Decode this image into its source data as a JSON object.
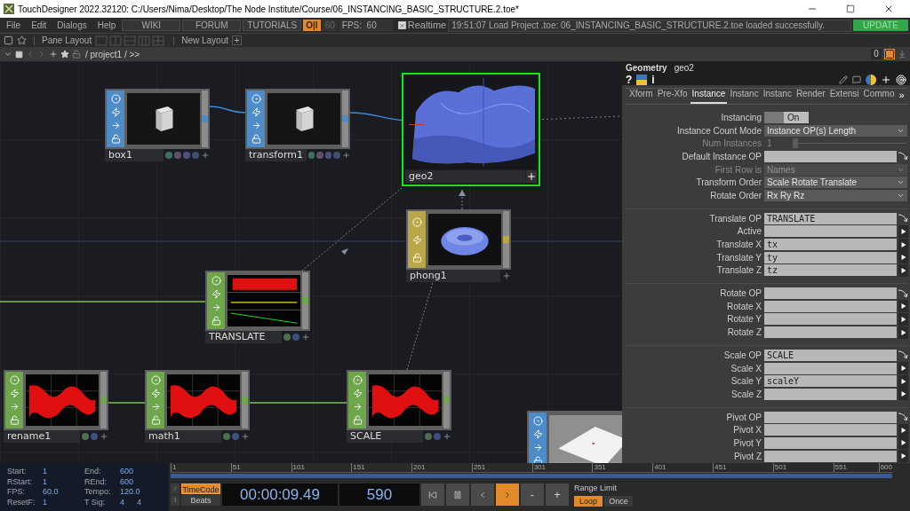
{
  "window": {
    "title": "TouchDesigner 2022.32120: C:/Users/Nima/Desktop/The Node Institute/Course/06_INSTANCING_BASIC_STRUCTURE.2.toe*"
  },
  "menu": [
    "File",
    "Edit",
    "Dialogs",
    "Help"
  ],
  "links": [
    "WIKI",
    "FORUM",
    "TUTORIALS"
  ],
  "perform_button": "O|I",
  "cook_rate": "60",
  "fps": "FPS:  60",
  "realtime": {
    "label": "Realtime",
    "checked": true
  },
  "status_message": "19:51:07 Load Project .toe: 06_INSTANCING_BASIC_STRUCTURE.2.toe loaded successfully.",
  "update_button": "UPDATE",
  "layout_bar": {
    "pane_layout": "Pane Layout",
    "new_layout": "New Layout",
    "add": "+"
  },
  "path_bar": {
    "path": "/ project1 / >>",
    "count": "0"
  },
  "nodes": [
    {
      "name": "box1",
      "kind": "sop",
      "selected": false
    },
    {
      "name": "transform1",
      "kind": "sop",
      "selected": false
    },
    {
      "name": "geo2",
      "kind": "comp",
      "selected": true
    },
    {
      "name": "phong1",
      "kind": "mat",
      "selected": false
    },
    {
      "name": "TRANSLATE",
      "kind": "chop",
      "selected": false
    },
    {
      "name": "rename1",
      "kind": "chop",
      "selected": false
    },
    {
      "name": "math1",
      "kind": "chop",
      "selected": false
    },
    {
      "name": "SCALE",
      "kind": "chop",
      "selected": false
    },
    {
      "kind": "sop",
      "selected": false
    }
  ],
  "parameters": {
    "op_type": "Geometry",
    "op_name": "geo2",
    "help": "?",
    "info": "i",
    "tabs": [
      {
        "label": "Xform",
        "selected": false
      },
      {
        "label": "Pre-Xfo",
        "selected": false
      },
      {
        "label": "Instance",
        "selected": true
      },
      {
        "label": "Instanc",
        "selected": false
      },
      {
        "label": "Instanc",
        "selected": false
      },
      {
        "label": "Render",
        "selected": false
      },
      {
        "label": "Extensi",
        "selected": false
      },
      {
        "label": "Commo",
        "selected": false
      }
    ],
    "more_tabs": "»",
    "sections": [
      [
        {
          "kind": "toggle",
          "label": "Instancing",
          "value": "On",
          "on": true,
          "disabled": false
        },
        {
          "kind": "menu",
          "label": "Instance Count Mode",
          "value": "Instance OP(s) Length",
          "disabled": false
        },
        {
          "kind": "slider",
          "label": "Num Instances",
          "value": "1",
          "level": 0,
          "disabled": true
        },
        {
          "kind": "op",
          "label": "Default Instance OP",
          "disabled": false
        },
        {
          "kind": "menu",
          "label": "First Row is",
          "value": "Names",
          "disabled": true
        },
        {
          "kind": "menu",
          "label": "Transform Order",
          "value": "Scale Rotate Translate",
          "disabled": false
        },
        {
          "kind": "menu",
          "label": "Rotate Order",
          "value": "Rx Ry Rz",
          "disabled": false
        }
      ],
      [
        {
          "kind": "op",
          "label": "Translate OP",
          "value": "TRANSLATE"
        },
        {
          "kind": "field",
          "label": "Active"
        },
        {
          "kind": "field",
          "label": "Translate X",
          "value": "tx"
        },
        {
          "kind": "field",
          "label": "Translate Y",
          "value": "ty"
        },
        {
          "kind": "field",
          "label": "Translate Z",
          "value": "tz"
        }
      ],
      [
        {
          "kind": "op",
          "label": "Rotate OP"
        },
        {
          "kind": "field",
          "label": "Rotate X"
        },
        {
          "kind": "field",
          "label": "Rotate Y"
        },
        {
          "kind": "field",
          "label": "Rotate Z"
        }
      ],
      [
        {
          "kind": "op",
          "label": "Scale OP",
          "value": "SCALE"
        },
        {
          "kind": "field",
          "label": "Scale X"
        },
        {
          "kind": "field",
          "label": "Scale Y",
          "value": "scaleY"
        },
        {
          "kind": "field",
          "label": "Scale Z"
        }
      ],
      [
        {
          "kind": "op",
          "label": "Pivot OP"
        },
        {
          "kind": "field",
          "label": "Pivot X"
        },
        {
          "kind": "field",
          "label": "Pivot Y"
        },
        {
          "kind": "field",
          "label": "Pivot Z"
        }
      ]
    ]
  },
  "timeline": {
    "info": [
      {
        "label": "Start:",
        "value": "1"
      },
      {
        "label": "End:",
        "value": "600"
      },
      {
        "label": "RStart:",
        "value": "1"
      },
      {
        "label": "REnd:",
        "value": "600"
      },
      {
        "label": "FPS:",
        "value": "60.0"
      },
      {
        "label": "Tempo:",
        "value": "120.0"
      },
      {
        "label": "ResetF:",
        "value": "1"
      },
      {
        "label": "T Sig:",
        "value": "4",
        "value2": "4"
      }
    ],
    "ruler": [
      "1",
      "51",
      "101",
      "151",
      "201",
      "251",
      "301",
      "351",
      "401",
      "451",
      "501",
      "551",
      "600"
    ],
    "side_buttons": [
      "/",
      "I"
    ],
    "time_modes": [
      {
        "label": "TimeCode",
        "selected": true
      },
      {
        "label": "Beats",
        "selected": false
      }
    ],
    "timecode": "00:00:09.49",
    "frame": "590",
    "transport": [
      {
        "kind": "start",
        "selected": false
      },
      {
        "kind": "pause",
        "selected": false
      },
      {
        "kind": "back",
        "selected": false
      },
      {
        "kind": "play",
        "selected": true
      },
      {
        "kind": "minus",
        "label": "-",
        "selected": false
      },
      {
        "kind": "plus",
        "label": "+",
        "selected": false
      }
    ],
    "range_label": "Range Limit",
    "range_modes": [
      {
        "label": "Loop",
        "selected": true
      },
      {
        "label": "Once",
        "selected": false
      }
    ]
  }
}
